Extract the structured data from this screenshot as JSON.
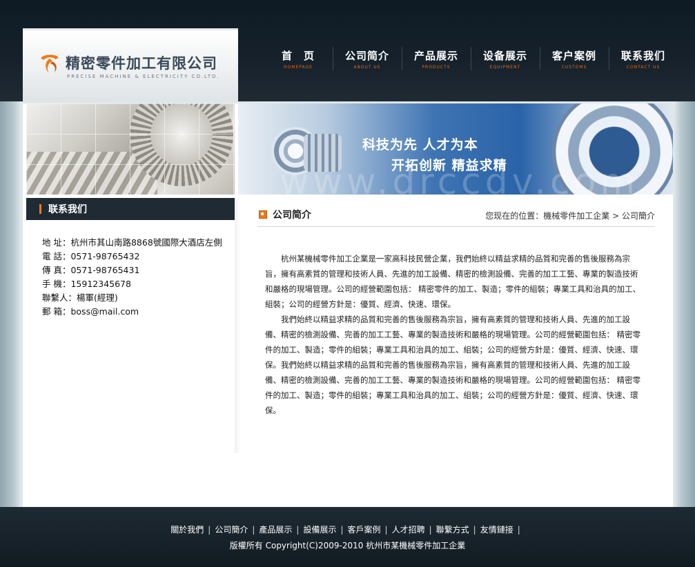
{
  "header": {
    "company_cn": "精密零件加工有限公司",
    "company_en": "PRECISE MACHINE & ELECTRICITY CO.LTD.",
    "nav": [
      {
        "cn": "首　页",
        "en": "HOMEPAGE"
      },
      {
        "cn": "公司简介",
        "en": "ABOUT US"
      },
      {
        "cn": "产品展示",
        "en": "PRODUCTS"
      },
      {
        "cn": "设备展示",
        "en": "EQUIPMENT"
      },
      {
        "cn": "客户案例",
        "en": "CUSTOMS"
      },
      {
        "cn": "联系我们",
        "en": "CONTACT US"
      }
    ],
    "accent": "#e46a12"
  },
  "banner": {
    "line1": "科技为先 人才为本",
    "line2": "开拓创新 精益求精",
    "watermark": "www.drccdv.com"
  },
  "sidebar": {
    "title": "联系我们",
    "contacts": [
      "地 址：杭州市其山南路8868號國際大酒店左側",
      "電 話：0571-98765432",
      "傳 真：0571-98765431",
      "手 機：15912345678",
      "聯繫人：楊軍(經理)",
      "郵 箱：boss@mail.com"
    ]
  },
  "main": {
    "section_title": "公司简介",
    "breadcrumb": {
      "prefix": "您现在的位置：",
      "home": "機械零件加工企業",
      "sep": " > ",
      "current": "公司簡介"
    },
    "paragraphs": [
      "杭州某機械零件加工企業是一家高科技民營企業，我們始終以精益求精的品質和完善的售後服務為宗旨，擁有高素質的管理和技術人員、先進的加工設備、精密的檢測設備、完善的加工工藝、專業的製造技術和嚴格的現場管理。公司的經營範圍包括： 精密零件的加工、製造；零件的組裝；專業工具和治具的加工、組裝；公司的經營方針是：優質、經濟、快速、環保。",
      "我們始終以精益求精的品質和完善的售後服務為宗旨，擁有高素質的管理和技術人員、先進的加工設備、精密的檢測設備、完善的加工工藝、專業的製造技術和嚴格的現場管理。公司的經營範圍包括： 精密零件的加工、製造；零件的組裝；專業工具和治具的加工、組裝；公司的經營方針是：優質、經濟、快速、環保。我們始終以精益求精的品質和完善的售後服務為宗旨，擁有高素質的管理和技術人員、先進的加工設備、精密的檢測設備、完善的加工工藝、專業的製造技術和嚴格的現場管理。公司的經營範圍包括： 精密零件的加工、製造；零件的組裝；專業工具和治具的加工、組裝；公司的經營方針是：優質、經濟、快速、環保。"
    ]
  },
  "footer": {
    "links": [
      "關於我們",
      "公司簡介",
      "產品展示",
      "設備展示",
      "客戶案例",
      "人才招聘",
      "聯繫方式",
      "友情鏈接"
    ],
    "separator": "|",
    "copyright": "版權所有 Copyright(C)2009-2010 杭州市某機械零件加工企業"
  }
}
